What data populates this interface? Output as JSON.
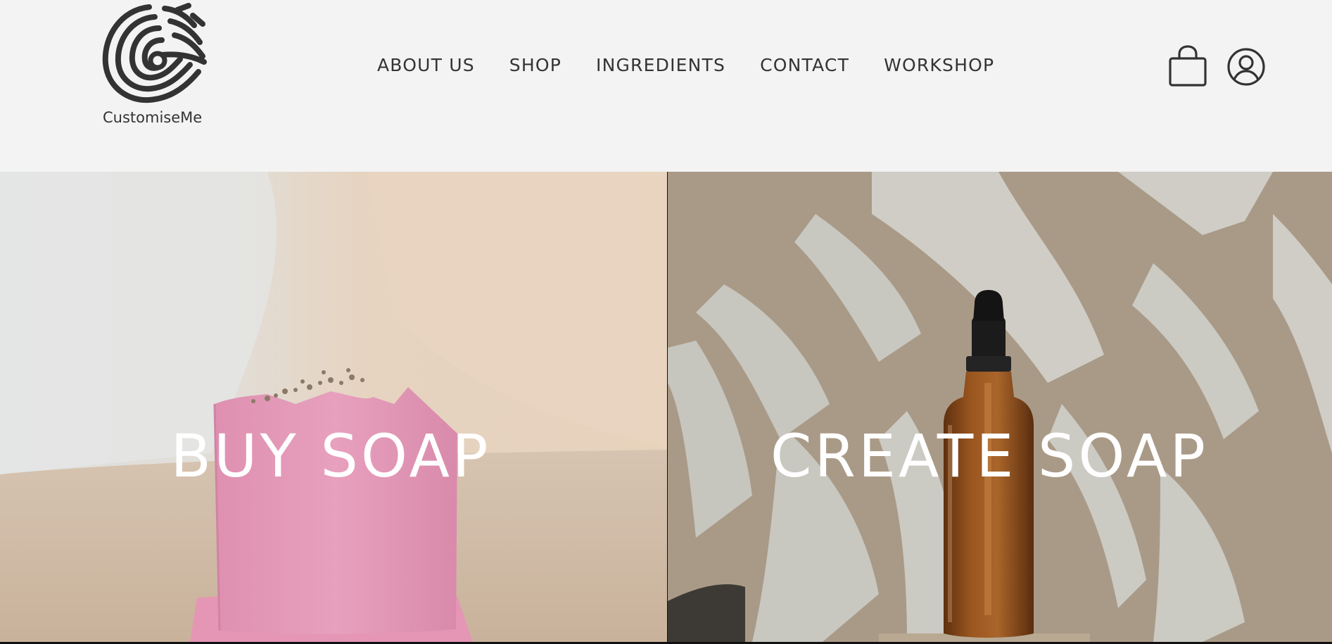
{
  "brand": {
    "name": "CustomiseMe"
  },
  "nav": {
    "items": [
      {
        "label": "ABOUT US"
      },
      {
        "label": "SHOP"
      },
      {
        "label": "INGREDIENTS"
      },
      {
        "label": "CONTACT"
      },
      {
        "label": "WORKSHOP"
      }
    ]
  },
  "header_icons": {
    "cart": "shopping-bag-icon",
    "account": "user-account-icon"
  },
  "hero": {
    "left": {
      "title": "BUY SOAP",
      "image": "pink-soap-bar-photo"
    },
    "right": {
      "title": "CREATE SOAP",
      "image": "amber-dropper-bottle-photo"
    }
  },
  "colors": {
    "background": "#f3f3f3",
    "text": "#333333",
    "hero_text": "#ffffff",
    "soap_pink": "#e79ab8",
    "bottle_amber": "#8a4a1c"
  }
}
